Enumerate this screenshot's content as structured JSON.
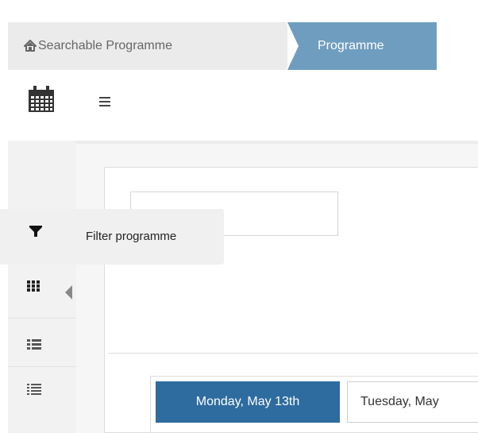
{
  "breadcrumb": {
    "home_label": "Searchable Programme",
    "current_label": "Programme"
  },
  "toolbar": {
    "calendar_icon": "calendar-icon",
    "menu_icon": "hamburger-icon"
  },
  "sidebar": {
    "items": [
      {
        "icon": "filter-icon"
      },
      {
        "icon": "grid-icon",
        "active": true
      },
      {
        "icon": "list-icon"
      },
      {
        "icon": "list-detailed-icon"
      }
    ]
  },
  "tooltip": {
    "label": "Filter programme"
  },
  "day_tabs": {
    "active_label": "Monday, May 13th",
    "next_label": "Tuesday, May"
  },
  "colors": {
    "breadcrumb_active": "#6f9dbf",
    "breadcrumb_inactive": "#ebebeb",
    "day_tab_active": "#2e6c9f",
    "sidebar_bg": "#f2f2f2",
    "tooltip_bg": "#f0f0f0"
  }
}
